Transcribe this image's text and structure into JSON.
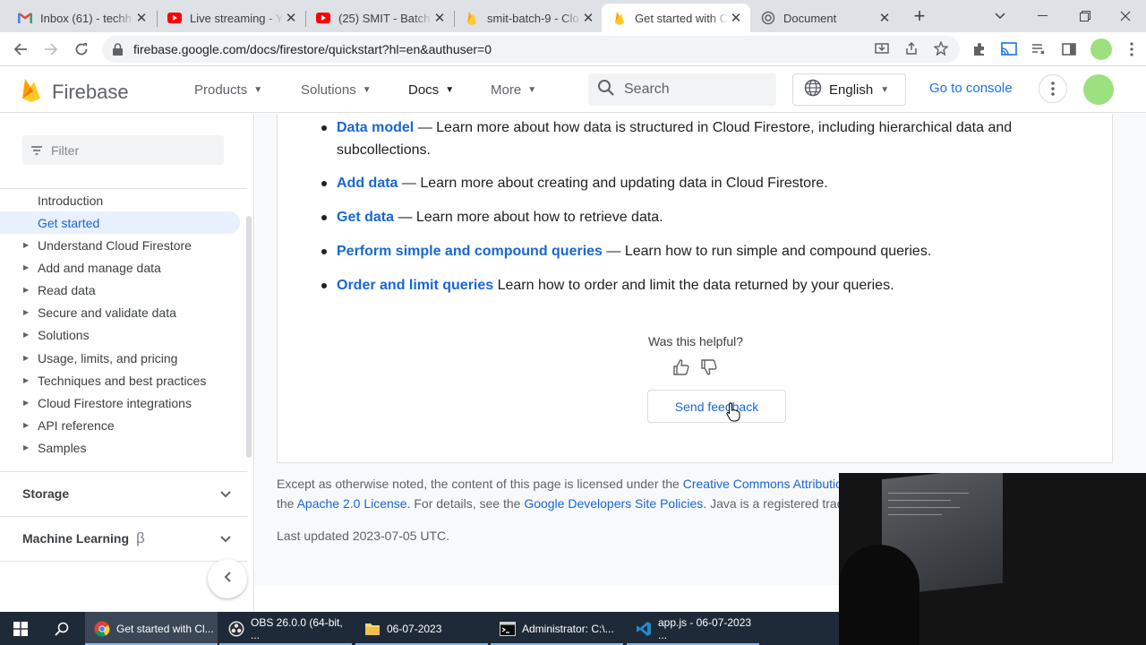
{
  "browser": {
    "tabs": [
      {
        "title": "Inbox (61) - techh",
        "icon": "gmail-icon"
      },
      {
        "title": "Live streaming - Y",
        "icon": "youtube-icon"
      },
      {
        "title": "(25) SMIT - Batch",
        "icon": "youtube-icon"
      },
      {
        "title": "smit-batch-9 - Clo",
        "icon": "firebase-icon"
      },
      {
        "title": "Get started with C",
        "icon": "firebase-icon",
        "active": true
      },
      {
        "title": "Document",
        "icon": "globe-icon"
      }
    ],
    "url": "firebase.google.com/docs/firestore/quickstart?hl=en&authuser=0"
  },
  "header": {
    "brand": "Firebase",
    "nav": [
      {
        "label": "Products"
      },
      {
        "label": "Solutions"
      },
      {
        "label": "Docs",
        "active": true
      },
      {
        "label": "More"
      }
    ],
    "search_placeholder": "Search",
    "language": "English",
    "console": "Go to console"
  },
  "sidebar": {
    "filter_placeholder": "Filter",
    "items": [
      {
        "label": "Introduction",
        "expandable": false
      },
      {
        "label": "Get started",
        "expandable": false,
        "selected": true
      },
      {
        "label": "Understand Cloud Firestore",
        "expandable": true
      },
      {
        "label": "Add and manage data",
        "expandable": true
      },
      {
        "label": "Read data",
        "expandable": true
      },
      {
        "label": "Secure and validate data",
        "expandable": true
      },
      {
        "label": "Solutions",
        "expandable": true
      },
      {
        "label": "Usage, limits, and pricing",
        "expandable": true
      },
      {
        "label": "Techniques and best practices",
        "expandable": true
      },
      {
        "label": "Cloud Firestore integrations",
        "expandable": true
      },
      {
        "label": "API reference",
        "expandable": true
      },
      {
        "label": "Samples",
        "expandable": true
      }
    ],
    "sections": [
      {
        "label": "Storage"
      },
      {
        "label": "Machine Learning",
        "badge": "β"
      }
    ]
  },
  "content": {
    "bullets": [
      {
        "link": "Data model",
        "text": " — Learn more about how data is structured in Cloud Firestore, including hierarchical data and subcollections."
      },
      {
        "link": "Add data",
        "text": " — Learn more about creating and updating data in Cloud Firestore."
      },
      {
        "link": "Get data",
        "text": " — Learn more about how to retrieve data."
      },
      {
        "link": "Perform simple and compound queries",
        "text": " — Learn how to run simple and compound queries."
      },
      {
        "link": "Order and limit queries",
        "text": " Learn how to order and limit the data returned by your queries."
      }
    ],
    "helpful_question": "Was this helpful?",
    "send_feedback": "Send feedback"
  },
  "footer": {
    "line1_text": "Except as otherwise noted, the content of this page is licensed under the ",
    "line1_link": "Creative Commons Attribution",
    "line2_pre": "the ",
    "line2_link1": "Apache 2.0 License",
    "line2_mid": ". For details, see the ",
    "line2_link2": "Google Developers Site Policies",
    "line2_post": ". Java is a registered tradem",
    "last_updated": "Last updated 2023-07-05 UTC."
  },
  "taskbar": {
    "apps": [
      {
        "label": "Get started with Cl...",
        "icon": "chrome-icon",
        "active": true
      },
      {
        "label": "OBS 26.0.0 (64-bit, ...",
        "icon": "obs-icon"
      },
      {
        "label": "06-07-2023",
        "icon": "folder-icon"
      },
      {
        "label": "Administrator: C:\\...",
        "icon": "terminal-icon"
      },
      {
        "label": "app.js - 06-07-2023 ...",
        "icon": "vscode-icon"
      }
    ]
  },
  "colors": {
    "link": "#1967d2",
    "accent": "#1a73e8",
    "selected_bg": "#e8f0fe",
    "firebase_yellow": "#ffca28",
    "firebase_orange": "#f57c00"
  }
}
